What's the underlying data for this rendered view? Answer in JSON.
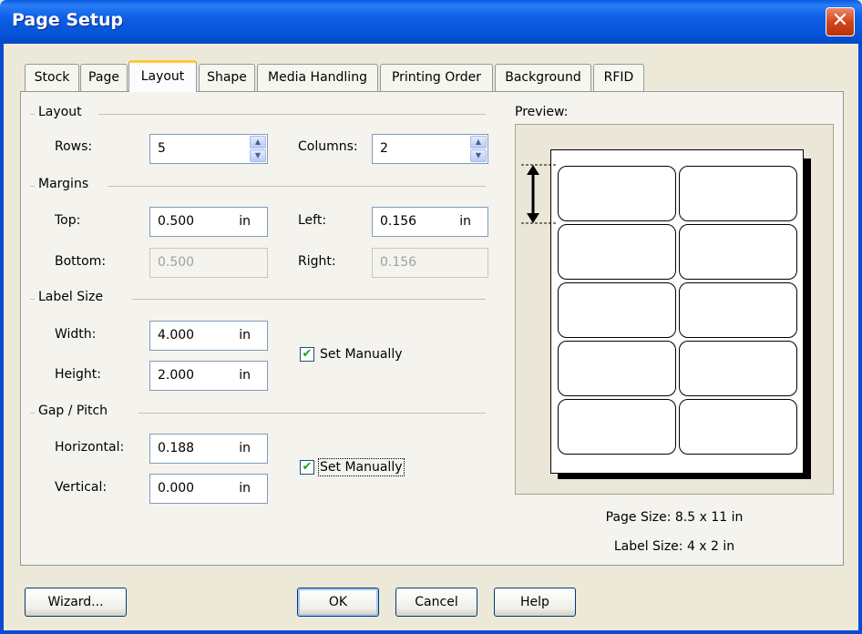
{
  "window": {
    "title": "Page Setup"
  },
  "tabs": [
    {
      "label": "Stock",
      "active": false
    },
    {
      "label": "Page",
      "active": false
    },
    {
      "label": "Layout",
      "active": true
    },
    {
      "label": "Shape",
      "active": false
    },
    {
      "label": "Media Handling",
      "active": false
    },
    {
      "label": "Printing Order",
      "active": false
    },
    {
      "label": "Background",
      "active": false
    },
    {
      "label": "RFID",
      "active": false
    }
  ],
  "layout_group": {
    "heading": "Layout",
    "rows_label": "Rows:",
    "rows_value": "5",
    "columns_label": "Columns:",
    "columns_value": "2"
  },
  "margins_group": {
    "heading": "Margins",
    "top_label": "Top:",
    "top_value": "0.500",
    "top_unit": "in",
    "left_label": "Left:",
    "left_value": "0.156",
    "left_unit": "in",
    "bottom_label": "Bottom:",
    "bottom_value": "0.500",
    "right_label": "Right:",
    "right_value": "0.156"
  },
  "label_size_group": {
    "heading": "Label Size",
    "width_label": "Width:",
    "width_value": "4.000",
    "width_unit": "in",
    "height_label": "Height:",
    "height_value": "2.000",
    "height_unit": "in",
    "set_manually_label": "Set Manually",
    "set_manually_checked": true
  },
  "gap_group": {
    "heading": "Gap / Pitch",
    "horizontal_label": "Horizontal:",
    "horizontal_value": "0.188",
    "horizontal_unit": "in",
    "vertical_label": "Vertical:",
    "vertical_value": "0.000",
    "vertical_unit": "in",
    "set_manually_label": "Set Manually",
    "set_manually_checked": true
  },
  "preview": {
    "heading": "Preview:",
    "page_size": "Page Size:  8.5 x 11 in",
    "label_size": "Label Size:  4 x 2 in",
    "rows": 5,
    "columns": 2
  },
  "buttons": {
    "wizard": "Wizard...",
    "ok": "OK",
    "cancel": "Cancel",
    "help": "Help"
  },
  "icons": {
    "close": "✕",
    "check": "✔",
    "spin_up": "▲",
    "spin_down": "▼"
  },
  "colors": {
    "titlebar": "#0553d6",
    "active_tab_accent": "#ffc83c",
    "dialog_bg": "#ece9d8"
  }
}
